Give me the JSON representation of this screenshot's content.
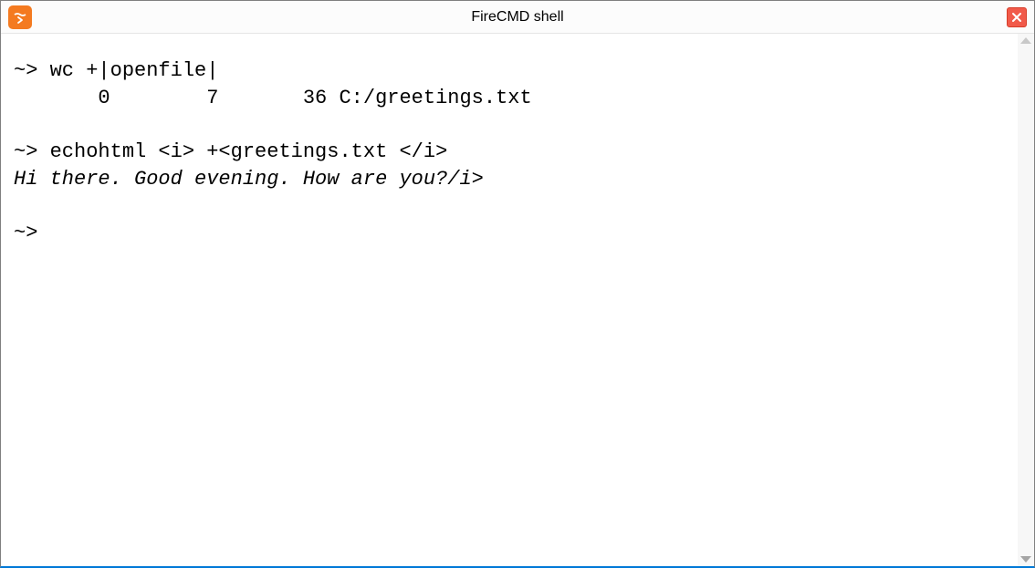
{
  "title": "FireCMD shell",
  "terminal": {
    "line1": "~> wc +|openfile|",
    "line2": "       0        7       36 C:/greetings.txt",
    "line3": "",
    "line4": "~> echohtml <i> +<greetings.txt </i>",
    "line5_italic": "Hi there. Good evening. How are you?/i>",
    "line6": "",
    "line7": "~> "
  }
}
